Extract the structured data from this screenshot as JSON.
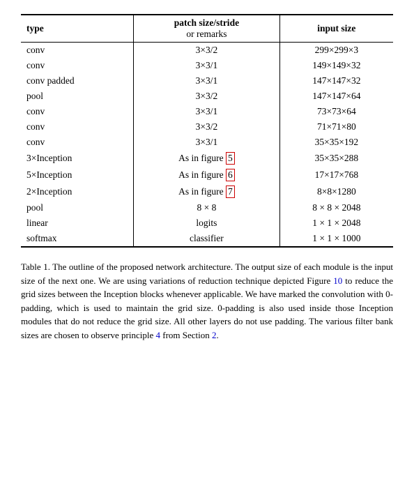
{
  "table": {
    "headers": [
      {
        "id": "type",
        "label": "type"
      },
      {
        "id": "patch",
        "label": "patch size/stride",
        "sublabel": "or remarks"
      },
      {
        "id": "input",
        "label": "input size"
      }
    ],
    "rows": [
      {
        "type": "conv",
        "patch": "3×3/2",
        "input": "299×299×3"
      },
      {
        "type": "conv",
        "patch": "3×3/1",
        "input": "149×149×32"
      },
      {
        "type": "conv padded",
        "patch": "3×3/1",
        "input": "147×147×32"
      },
      {
        "type": "pool",
        "patch": "3×3/2",
        "input": "147×147×64"
      },
      {
        "type": "conv",
        "patch": "3×3/1",
        "input": "73×73×64"
      },
      {
        "type": "conv",
        "patch": "3×3/2",
        "input": "71×71×80"
      },
      {
        "type": "conv",
        "patch": "3×3/1",
        "input": "35×35×192"
      },
      {
        "type": "3×Inception",
        "patch": "As in figure 5",
        "patch_highlight": "5",
        "input": "35×35×288"
      },
      {
        "type": "5×Inception",
        "patch": "As in figure 6",
        "patch_highlight": "6",
        "input": "17×17×768"
      },
      {
        "type": "2×Inception",
        "patch": "As in figure 7",
        "patch_highlight": "7",
        "input": "8×8×1280"
      },
      {
        "type": "pool",
        "patch": "8 × 8",
        "input": "8 × 8 × 2048"
      },
      {
        "type": "linear",
        "patch": "logits",
        "input": "1 × 1 × 2048"
      },
      {
        "type": "softmax",
        "patch": "classifier",
        "input": "1 × 1 × 1000"
      }
    ]
  },
  "caption": {
    "prefix": "Table 1. The outline of the proposed network architecture.  The output size of each module is the input size of the next one.  We are using variations of reduction technique depicted Figure ",
    "link1": "10",
    "middle1": " to reduce the grid sizes between the Inception blocks whenever applicable. We have marked the convolution with 0-padding, which is used to maintain the grid size.  0-padding is also used inside those Inception modules that do not reduce the grid size. All other layers do not use padding. The various filter bank sizes are chosen to observe principle ",
    "link2": "4",
    "middle2": " from Section ",
    "link3": "2",
    "suffix": "."
  }
}
